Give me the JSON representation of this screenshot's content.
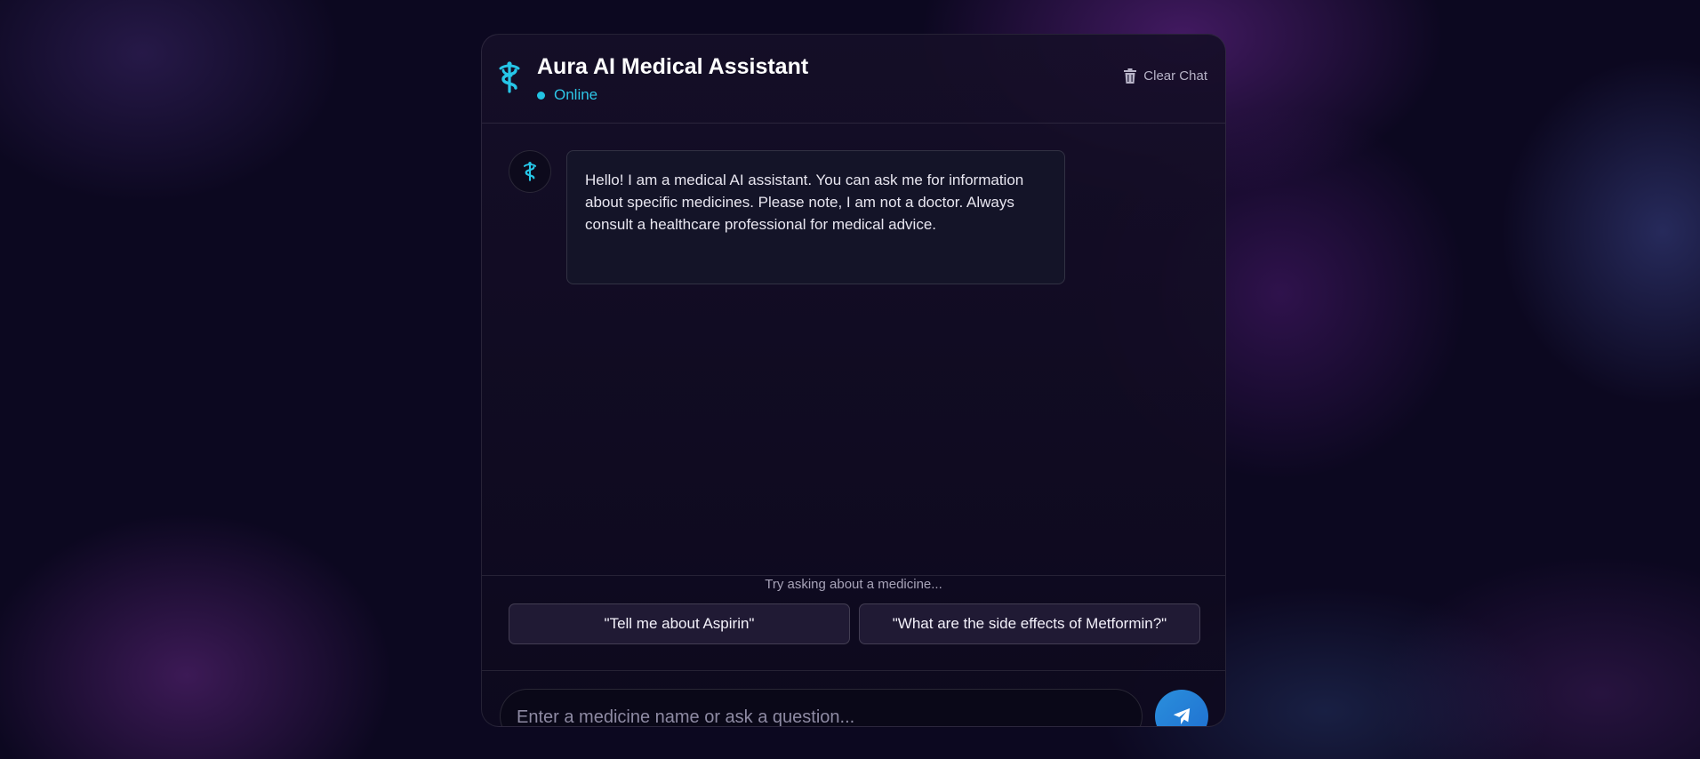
{
  "header": {
    "logo_icon": "caduceus-icon",
    "title": "Aura AI Medical Assistant",
    "status": "Online",
    "clear_label": "Clear Chat",
    "clear_icon": "trash-icon"
  },
  "messages": [
    {
      "sender": "assistant",
      "avatar_icon": "caduceus-icon",
      "text": "Hello! I am a medical AI assistant. You can ask me for information about specific medicines. Please note, I am not a doctor. Always consult a healthcare professional for medical advice."
    }
  ],
  "suggestions": {
    "hint": "Try asking about a medicine...",
    "items": [
      "\"Tell me about Aspirin\"",
      "\"What are the side effects of Metformin?\""
    ]
  },
  "composer": {
    "placeholder": "Enter a medicine name or ask a question...",
    "value": "",
    "send_icon": "send-icon"
  },
  "colors": {
    "accent": "#22c3e3",
    "send_button": "#1f6fd0",
    "background": "#0c0820"
  }
}
